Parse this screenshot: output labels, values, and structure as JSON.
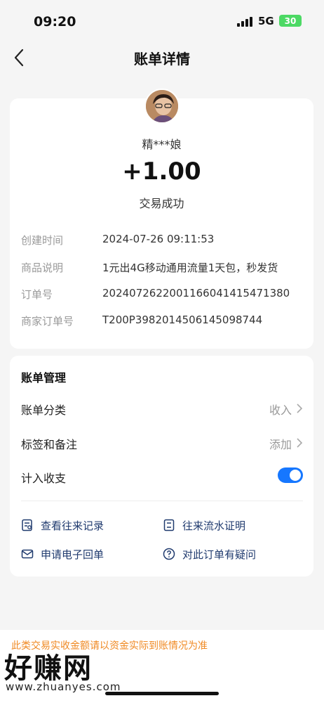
{
  "status_bar": {
    "time": "09:20",
    "network": "5G",
    "battery": "30"
  },
  "nav": {
    "title": "账单详情",
    "back_icon": "chevron-left-icon"
  },
  "transaction": {
    "name": "精***娘",
    "amount": "+1.00",
    "status": "交易成功",
    "details": [
      {
        "label": "创建时间",
        "value": "2024-07-26 09:11:53"
      },
      {
        "label": "商品说明",
        "value": "1元出4G移动通用流量1天包，秒发货"
      },
      {
        "label": "订单号",
        "value": "20240726220011660414154713​80"
      },
      {
        "label": "商家订单号",
        "value": "T200P3982014506145098744"
      }
    ]
  },
  "management": {
    "title": "账单管理",
    "category_label": "账单分类",
    "category_value": "收入",
    "tags_label": "标签和备注",
    "tags_value": "添加",
    "include_label": "计入收支",
    "include_on": true,
    "links": {
      "history": "查看往来记录",
      "statement": "往来流水证明",
      "receipt": "申请电子回单",
      "question": "对此订单有疑问"
    }
  },
  "notice": "此类交易实收金额请以资金实际到账情况为准",
  "watermark": {
    "text": "好赚网",
    "url": "www.zhuanyes.com"
  },
  "colors": {
    "accent": "#1677ff",
    "notice": "#f08a24",
    "background": "#f5f5f5"
  }
}
